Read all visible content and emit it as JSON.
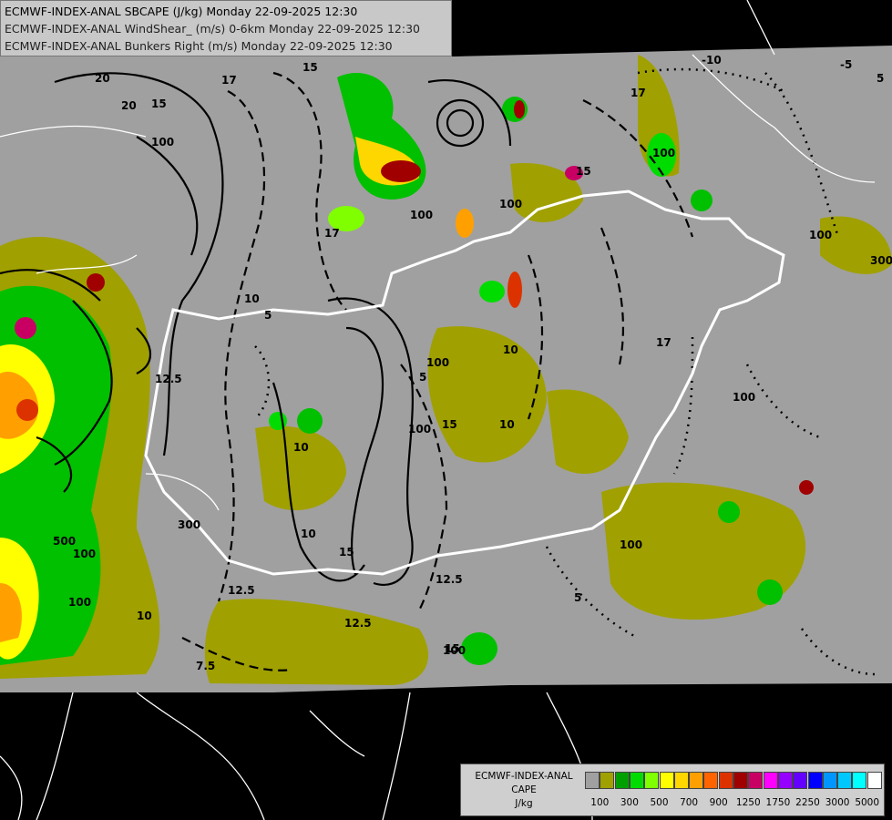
{
  "header": {
    "line1": "ECMWF-INDEX-ANAL SBCAPE (J/kg) Monday 22-09-2025 12:30",
    "line2": "ECMWF-INDEX-ANAL WindShear_ (m/s) 0-6km Monday 22-09-2025 12:30",
    "line3": "ECMWF-INDEX-ANAL Bunkers Right (m/s) Monday 22-09-2025 12:30"
  },
  "legend": {
    "title_line1": "ECMWF-INDEX-ANAL",
    "title_line2": "CAPE",
    "title_line3": "J/kg",
    "colors": [
      "#a0a0a0",
      "#a0a000",
      "#00a000",
      "#00dc00",
      "#80ff00",
      "#ffff00",
      "#ffd700",
      "#ffa000",
      "#ff6400",
      "#dc3200",
      "#a00000",
      "#c80064",
      "#ff00ff",
      "#9600ff",
      "#6400ff",
      "#0000ff",
      "#0096ff",
      "#00c8ff",
      "#00ffff",
      "#ffffff"
    ],
    "tick_labels": [
      "100",
      "300",
      "500",
      "700",
      "900",
      "1250",
      "1750",
      "2250",
      "3000",
      "5000"
    ]
  },
  "map_labels": [
    "20",
    "15",
    "17",
    "10",
    "20",
    "100",
    "12.5",
    "100",
    "17",
    "15",
    "5",
    "10",
    "15",
    "12.5",
    "17",
    "100",
    "100",
    "10",
    "100",
    "100",
    "100",
    "-10",
    "-5",
    "5",
    "300",
    "100",
    "15",
    "15",
    "5",
    "500",
    "100",
    "10",
    "7.5",
    "300",
    "10",
    "100",
    "17",
    "100",
    "12.5",
    "15",
    "100",
    "10",
    "12.5",
    "5"
  ],
  "colors": {
    "terrain": "#a0a0a0",
    "ocean": "#000000",
    "border": "#ffffff",
    "contour": "#000000"
  }
}
